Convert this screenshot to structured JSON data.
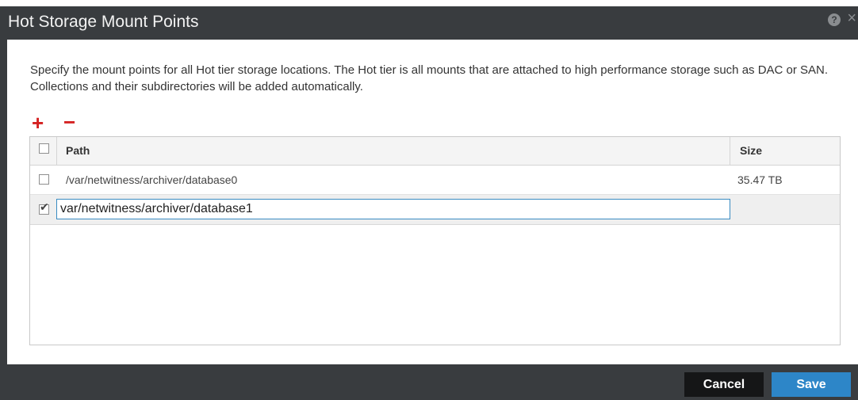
{
  "dialog": {
    "title": "Hot Storage Mount Points",
    "help_icon": "?",
    "close_icon": "×",
    "description": "Specify the mount points for all Hot tier storage locations. The Hot tier is all mounts that are attached to high performance storage such as DAC or SAN. Collections and their subdirectories will be added automatically."
  },
  "toolbar": {
    "add_symbol": "+",
    "remove_symbol": "−"
  },
  "table": {
    "columns": [
      "Path",
      "Size"
    ],
    "rows": [
      {
        "path": "/var/netwitness/archiver/database0",
        "size": "35.47 TB",
        "checked": false
      },
      {
        "path": "var/netwitness/archiver/database1",
        "size": "",
        "checked": true
      }
    ]
  },
  "footer": {
    "cancel_label": "Cancel",
    "save_label": "Save"
  },
  "colors": {
    "title_bar": "#393c3f",
    "accent": "#2d86c8",
    "icon_red": "#d42020"
  }
}
